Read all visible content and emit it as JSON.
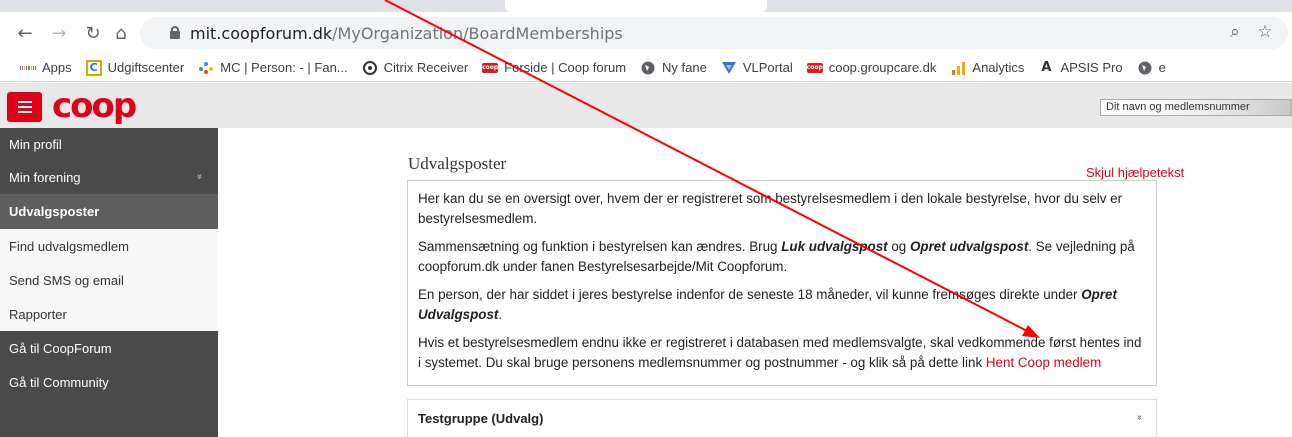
{
  "browser": {
    "url_host": "mit.coopforum.dk",
    "url_path": "/MyOrganization/BoardMemberships",
    "back_icon": "←",
    "forward_icon": "→",
    "reload_icon": "↻",
    "home_icon": "⌂",
    "zoom_icon": "⌕",
    "star_icon": "☆",
    "bookmarks": [
      {
        "label": "Apps",
        "icon": "apps-grid-icon"
      },
      {
        "label": "Udgiftscenter",
        "icon": "udgiftscenter-icon"
      },
      {
        "label": "MC | Person: - | Fan...",
        "icon": "mc-dots-icon"
      },
      {
        "label": "Citrix Receiver",
        "icon": "citrix-icon"
      },
      {
        "label": "Forside | Coop forum",
        "icon": "coop-icon"
      },
      {
        "label": "Ny fane",
        "icon": "globe-icon"
      },
      {
        "label": "VLPortal",
        "icon": "vlportal-icon"
      },
      {
        "label": "coop.groupcare.dk",
        "icon": "coop-icon"
      },
      {
        "label": "Analytics",
        "icon": "analytics-icon"
      },
      {
        "label": "APSIS Pro",
        "icon": "apsis-icon"
      },
      {
        "label": "e",
        "icon": "globe-icon"
      }
    ]
  },
  "header": {
    "logo": "coop",
    "user_placeholder": "Dit navn og medlemsnummer"
  },
  "sidebar": {
    "items": [
      {
        "label": "Min profil"
      },
      {
        "label": "Min forening",
        "chevron": "»"
      },
      {
        "label": "Udvalgsposter"
      },
      {
        "label": "Find udvalgsmedlem"
      },
      {
        "label": "Send SMS og email"
      },
      {
        "label": "Rapporter"
      },
      {
        "label": "Gå til CoopForum"
      },
      {
        "label": "Gå til Community"
      }
    ]
  },
  "main": {
    "title": "Udvalgsposter",
    "hide_help": "Skjul hjælpetekst",
    "help": {
      "p1": "Her kan du se en oversigt over, hvem der er registreret som bestyrelsesmedlem i den lokale bestyrelse, hvor du selv er bestyrelsesmedlem.",
      "p2_a": "Sammensætning og funktion i bestyrelsen kan ændres. Brug ",
      "p2_b": "Luk udvalgspost",
      "p2_c": " og ",
      "p2_d": "Opret udvalgspost",
      "p2_e": ". Se vejledning på coopforum.dk under fanen Bestyrelsesarbejde/Mit Coopforum.",
      "p3_a": "En person, der har siddet i jeres bestyrelse indenfor de seneste 18 måneder, vil kunne fremsøges direkte under ",
      "p3_b": "Opret Udvalgspost",
      "p3_c": ".",
      "p4_a": "Hvis et bestyrelsesmedlem endnu ikke er registreret i databasen med medlemsvalgte, skal vedkommende først hentes ind i systemet. Du skal bruge personens medlemsnummer og postnummer - og klik så på dette link ",
      "p4_link": "Hent Coop medlem"
    },
    "group": {
      "title": "Testgruppe (Udvalg)",
      "chevron": "»"
    }
  },
  "colors": {
    "brand_red": "#e1001a",
    "sidebar_bg": "#4a4a4a",
    "annotation_arrow": "#ff0000"
  }
}
